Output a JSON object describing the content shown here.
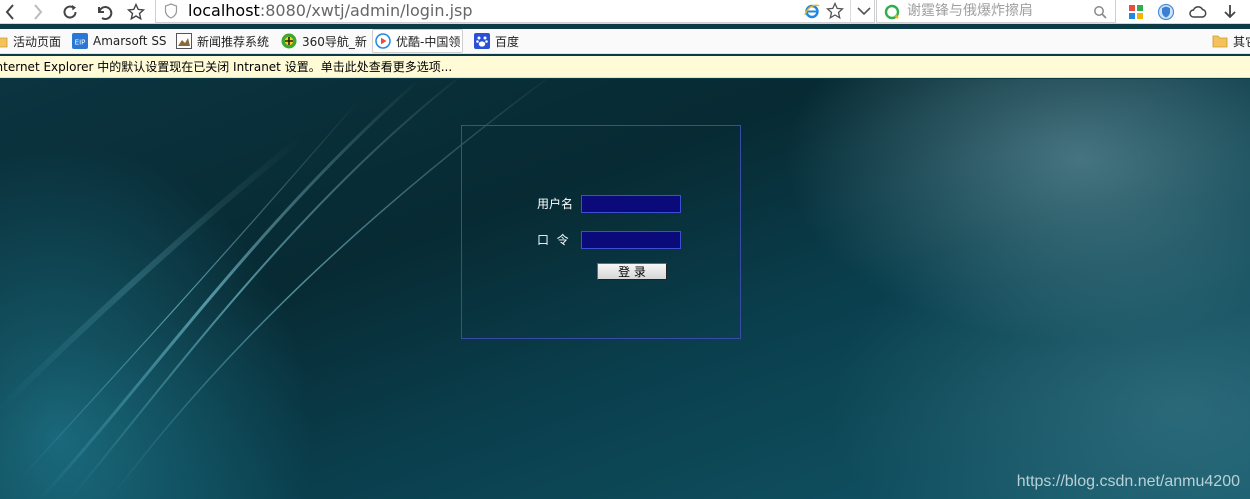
{
  "address_bar": {
    "url_host": "localhost",
    "url_rest": ":8080/xwtj/admin/login.jsp"
  },
  "search": {
    "placeholder": "谢霆锋与俄爆炸擦肩"
  },
  "bookmarks": [
    {
      "label": "活动页面",
      "icon": "folder-icon"
    },
    {
      "label": "Amarsoft SS",
      "icon": "eip-icon"
    },
    {
      "label": "新闻推荐系统",
      "icon": "news-icon"
    },
    {
      "label": "360导航_新",
      "icon": "360-icon"
    },
    {
      "label": "优酷-中国领",
      "icon": "youku-icon"
    },
    {
      "label": "百度",
      "icon": "baidu-paw-icon"
    },
    {
      "label": "其它",
      "icon": "folder-icon"
    }
  ],
  "infobar": {
    "text": "Internet Explorer 中的默认设置现在已关闭 Intranet 设置。单击此处查看更多选项..."
  },
  "login": {
    "username_label": "用户名",
    "password_label": "口  令",
    "submit_label": "登 录",
    "username_value": "",
    "password_value": ""
  },
  "colors": {
    "page_bg": "#0d3a47",
    "input_bg": "#0a0a7a",
    "box_border": "#3a4aa8",
    "infobar_bg": "#fffbd7"
  },
  "watermark": "https://blog.csdn.net/anmu4200"
}
